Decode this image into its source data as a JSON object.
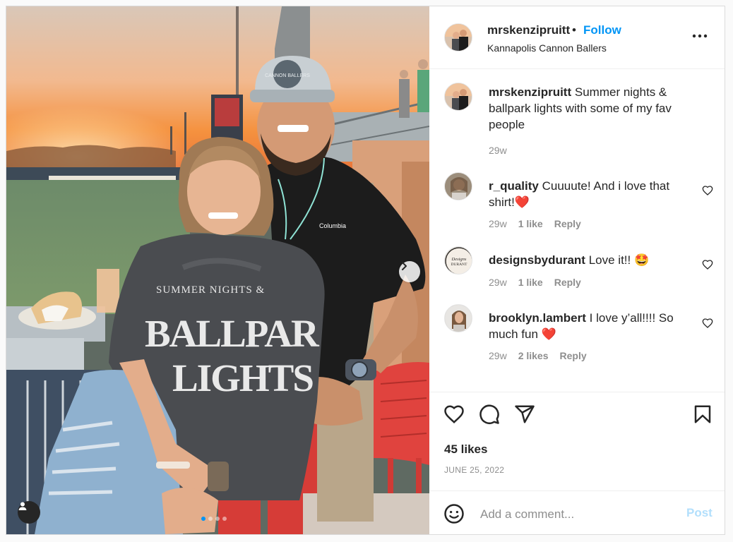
{
  "post": {
    "username": "mrskenzipruitt",
    "separator": "•",
    "follow_label": "Follow",
    "location": "Kannapolis Cannon Ballers",
    "caption": "Summer nights & ballpark lights with some of my fav people",
    "caption_time": "29w",
    "likes": "45 likes",
    "date": "JUNE 25, 2022",
    "image_dots": 4,
    "active_dot": 0
  },
  "comments": [
    {
      "username": "r_quality",
      "text": "Cuuuute! And i love that shirt!",
      "emoji": "❤️",
      "time": "29w",
      "likes": "1 like",
      "reply": "Reply"
    },
    {
      "username": "designsbydurant",
      "text": "Love it!!",
      "emoji": "🤩",
      "time": "29w",
      "likes": "1 like",
      "reply": "Reply"
    },
    {
      "username": "brooklyn.lambert",
      "text": "I love y’all!!!! So much fun",
      "emoji": "❤️",
      "time": "29w",
      "likes": "2 likes",
      "reply": "Reply"
    }
  ],
  "add_comment": {
    "placeholder": "Add a comment...",
    "post_label": "Post"
  },
  "colors": {
    "accent": "#0095f6",
    "post_disabled": "#b2dffc",
    "heart": "#ed4956",
    "muted": "#8e8e8e"
  },
  "icons": [
    "more-icon",
    "heart-icon",
    "comment-icon",
    "share-icon",
    "bookmark-icon",
    "emoji-icon",
    "user-tag-icon",
    "chevron-right-icon"
  ],
  "shirt_print": [
    "SUMMER NIGHTS &",
    "BALLPARK",
    "LIGHTS"
  ],
  "hat_text": "CANNON BALLERS",
  "logo_text": "Columbia",
  "designsbydurant_avatar_text": [
    "Designs",
    "DURANT"
  ]
}
